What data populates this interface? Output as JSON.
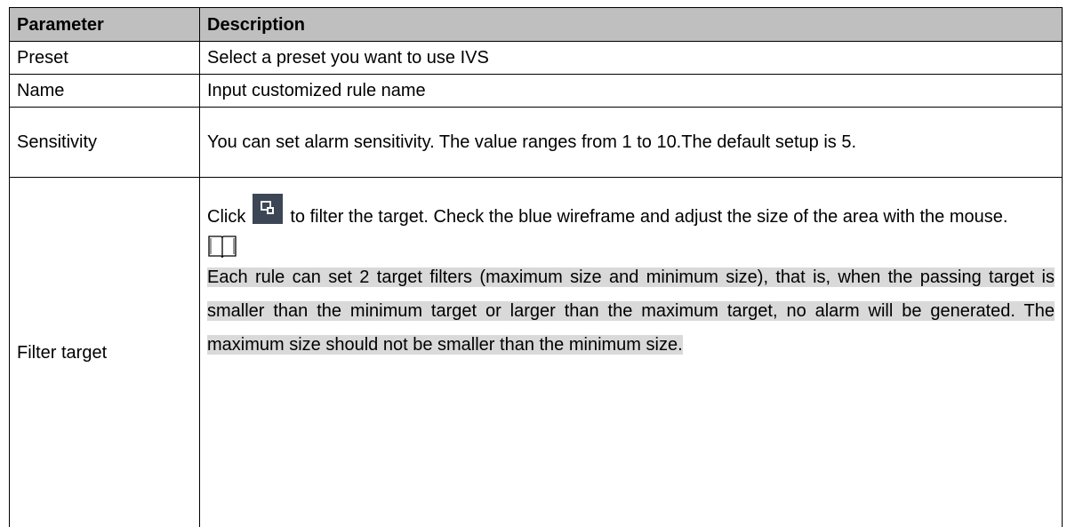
{
  "table": {
    "headers": {
      "parameter": "Parameter",
      "description": "Description"
    },
    "rows": [
      {
        "parameter": "Preset",
        "description": "Select a preset you want to use IVS"
      },
      {
        "parameter": "Name",
        "description": "Input customized rule name"
      },
      {
        "parameter": "Sensitivity",
        "description": "You can set alarm sensitivity. The value ranges from 1 to 10.The default setup is 5."
      },
      {
        "parameter": "Filter target",
        "description_before_icon": "Click",
        "description_after_icon": "to filter the target. Check the blue wireframe and adjust the size of the area with the mouse.",
        "note": "Each rule can set 2 target filters (maximum size and minimum size), that is, when the passing target is smaller than the minimum target or larger than the maximum target, no alarm will be generated. The maximum size should not be smaller than the minimum size."
      }
    ]
  },
  "icons": {
    "filter_target": "filter-target-icon",
    "note": "book-icon"
  },
  "colors": {
    "header_bg": "#bfbfbf",
    "note_highlight": "#d9d9d9",
    "icon_bg": "#3c4655"
  }
}
